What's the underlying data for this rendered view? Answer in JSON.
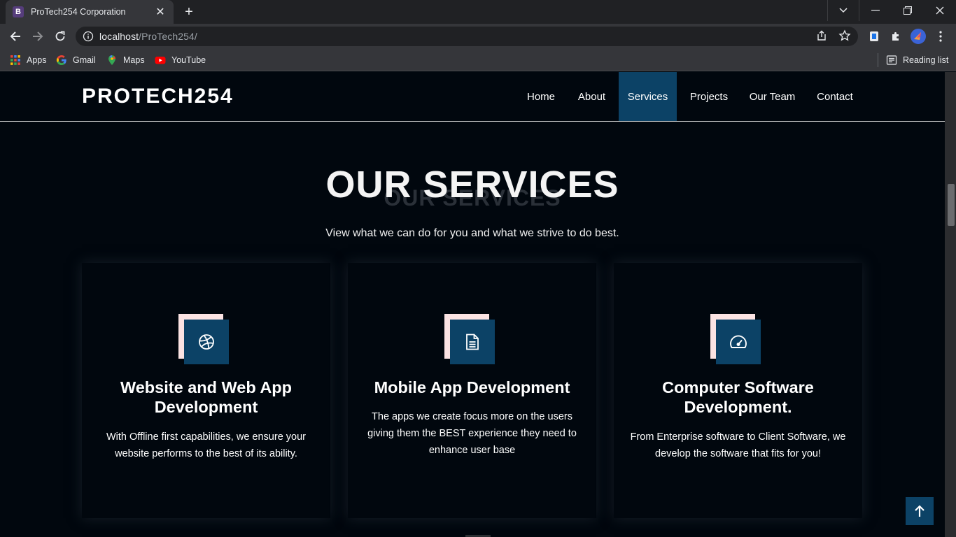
{
  "browser": {
    "tab_title": "ProTech254 Corporation",
    "tab_favicon_letter": "B",
    "url_host": "localhost",
    "url_path": "/ProTech254/",
    "bookmarks": [
      {
        "label": "Apps",
        "icon": "apps-grid-icon"
      },
      {
        "label": "Gmail",
        "icon": "google-icon"
      },
      {
        "label": "Maps",
        "icon": "maps-pin-icon"
      },
      {
        "label": "YouTube",
        "icon": "youtube-icon"
      }
    ],
    "reading_list_label": "Reading list"
  },
  "site": {
    "brand": "PROTECH254",
    "nav": [
      {
        "label": "Home",
        "active": false
      },
      {
        "label": "About",
        "active": false
      },
      {
        "label": "Services",
        "active": true
      },
      {
        "label": "Projects",
        "active": false
      },
      {
        "label": "Our Team",
        "active": false
      },
      {
        "label": "Contact",
        "active": false
      }
    ]
  },
  "services": {
    "title": "OUR SERVICES",
    "title_ghost": "OUR SERVICES",
    "subtitle": "View what we can do for you and what we strive to do best.",
    "cards": [
      {
        "icon": "dribbble-icon",
        "title": "Website and Web App Development",
        "text": "With Offline first capabilities, we ensure your website performs to the best of its ability."
      },
      {
        "icon": "document-icon",
        "title": "Mobile App Development",
        "text": "The apps we create focus more on the users giving them the BEST experience they need to enhance user base"
      },
      {
        "icon": "speedometer-icon",
        "title": "Computer Software Development.",
        "text": "From Enterprise software to Client Software, we develop the software that fits for you!"
      }
    ]
  },
  "colors": {
    "page_bg": "#01070e",
    "accent": "#0c4266",
    "icon_back": "#fbe3e3",
    "text": "#ffffff"
  }
}
